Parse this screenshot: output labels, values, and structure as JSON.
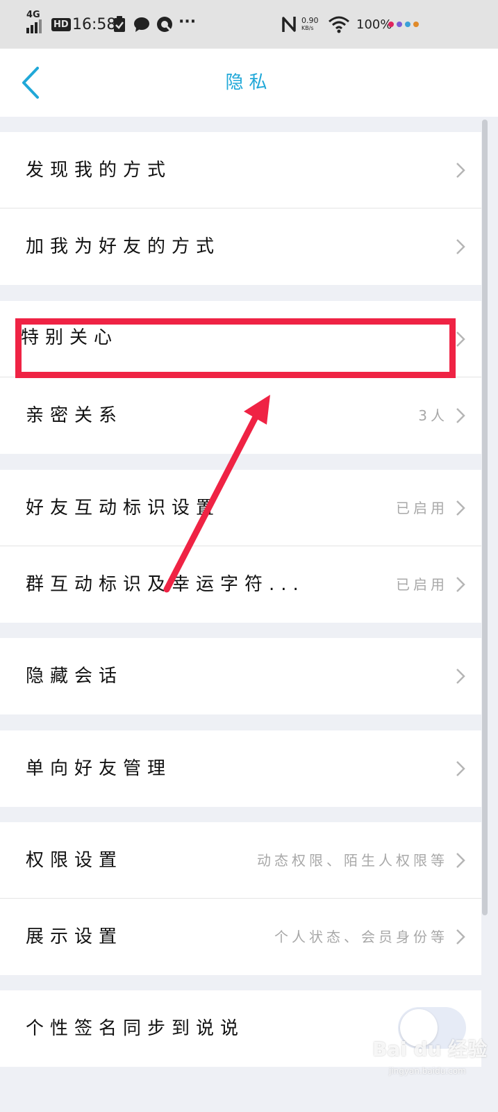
{
  "status_bar": {
    "network": "4G",
    "hd": "HD",
    "time": "16:58",
    "more": "···",
    "speed_value": "0.90",
    "speed_unit": "KB/s",
    "battery": "100%",
    "icons": [
      "signal-icon",
      "hd-badge",
      "clipboard-check-icon",
      "chat-bubble-icon",
      "q-app-icon",
      "more-icon",
      "nfc-icon",
      "wifi-icon",
      "color-dots"
    ]
  },
  "nav": {
    "title": "隐私",
    "back_icon": "chevron-left-icon"
  },
  "rows": [
    {
      "label": "发现我的方式",
      "value": ""
    },
    {
      "label": "加我为好友的方式",
      "value": ""
    },
    {
      "label": "特别关心",
      "value": ""
    },
    {
      "label": "亲密关系",
      "value": "3人"
    },
    {
      "label": "好友互动标识设置",
      "value": "已启用"
    },
    {
      "label": "群互动标识及幸运字符...",
      "value": "已启用"
    },
    {
      "label": "隐藏会话",
      "value": ""
    },
    {
      "label": "单向好友管理",
      "value": ""
    },
    {
      "label": "权限设置",
      "value": "动态权限、陌生人权限等"
    },
    {
      "label": "展示设置",
      "value": "个人状态、会员身份等"
    },
    {
      "label": "个性签名同步到说说",
      "value": "",
      "toggle_on": false
    }
  ],
  "annotation": {
    "highlight_color": "#ef2344",
    "target": "特别关心"
  },
  "watermark": {
    "brand": "Bai du 经验",
    "url": "jingyan.baidu.com"
  },
  "colors": {
    "accent": "#20a8d8",
    "background": "#eef0f5",
    "status_bar": "#e3e3e3",
    "secondary_text": "#a8a8a8"
  }
}
